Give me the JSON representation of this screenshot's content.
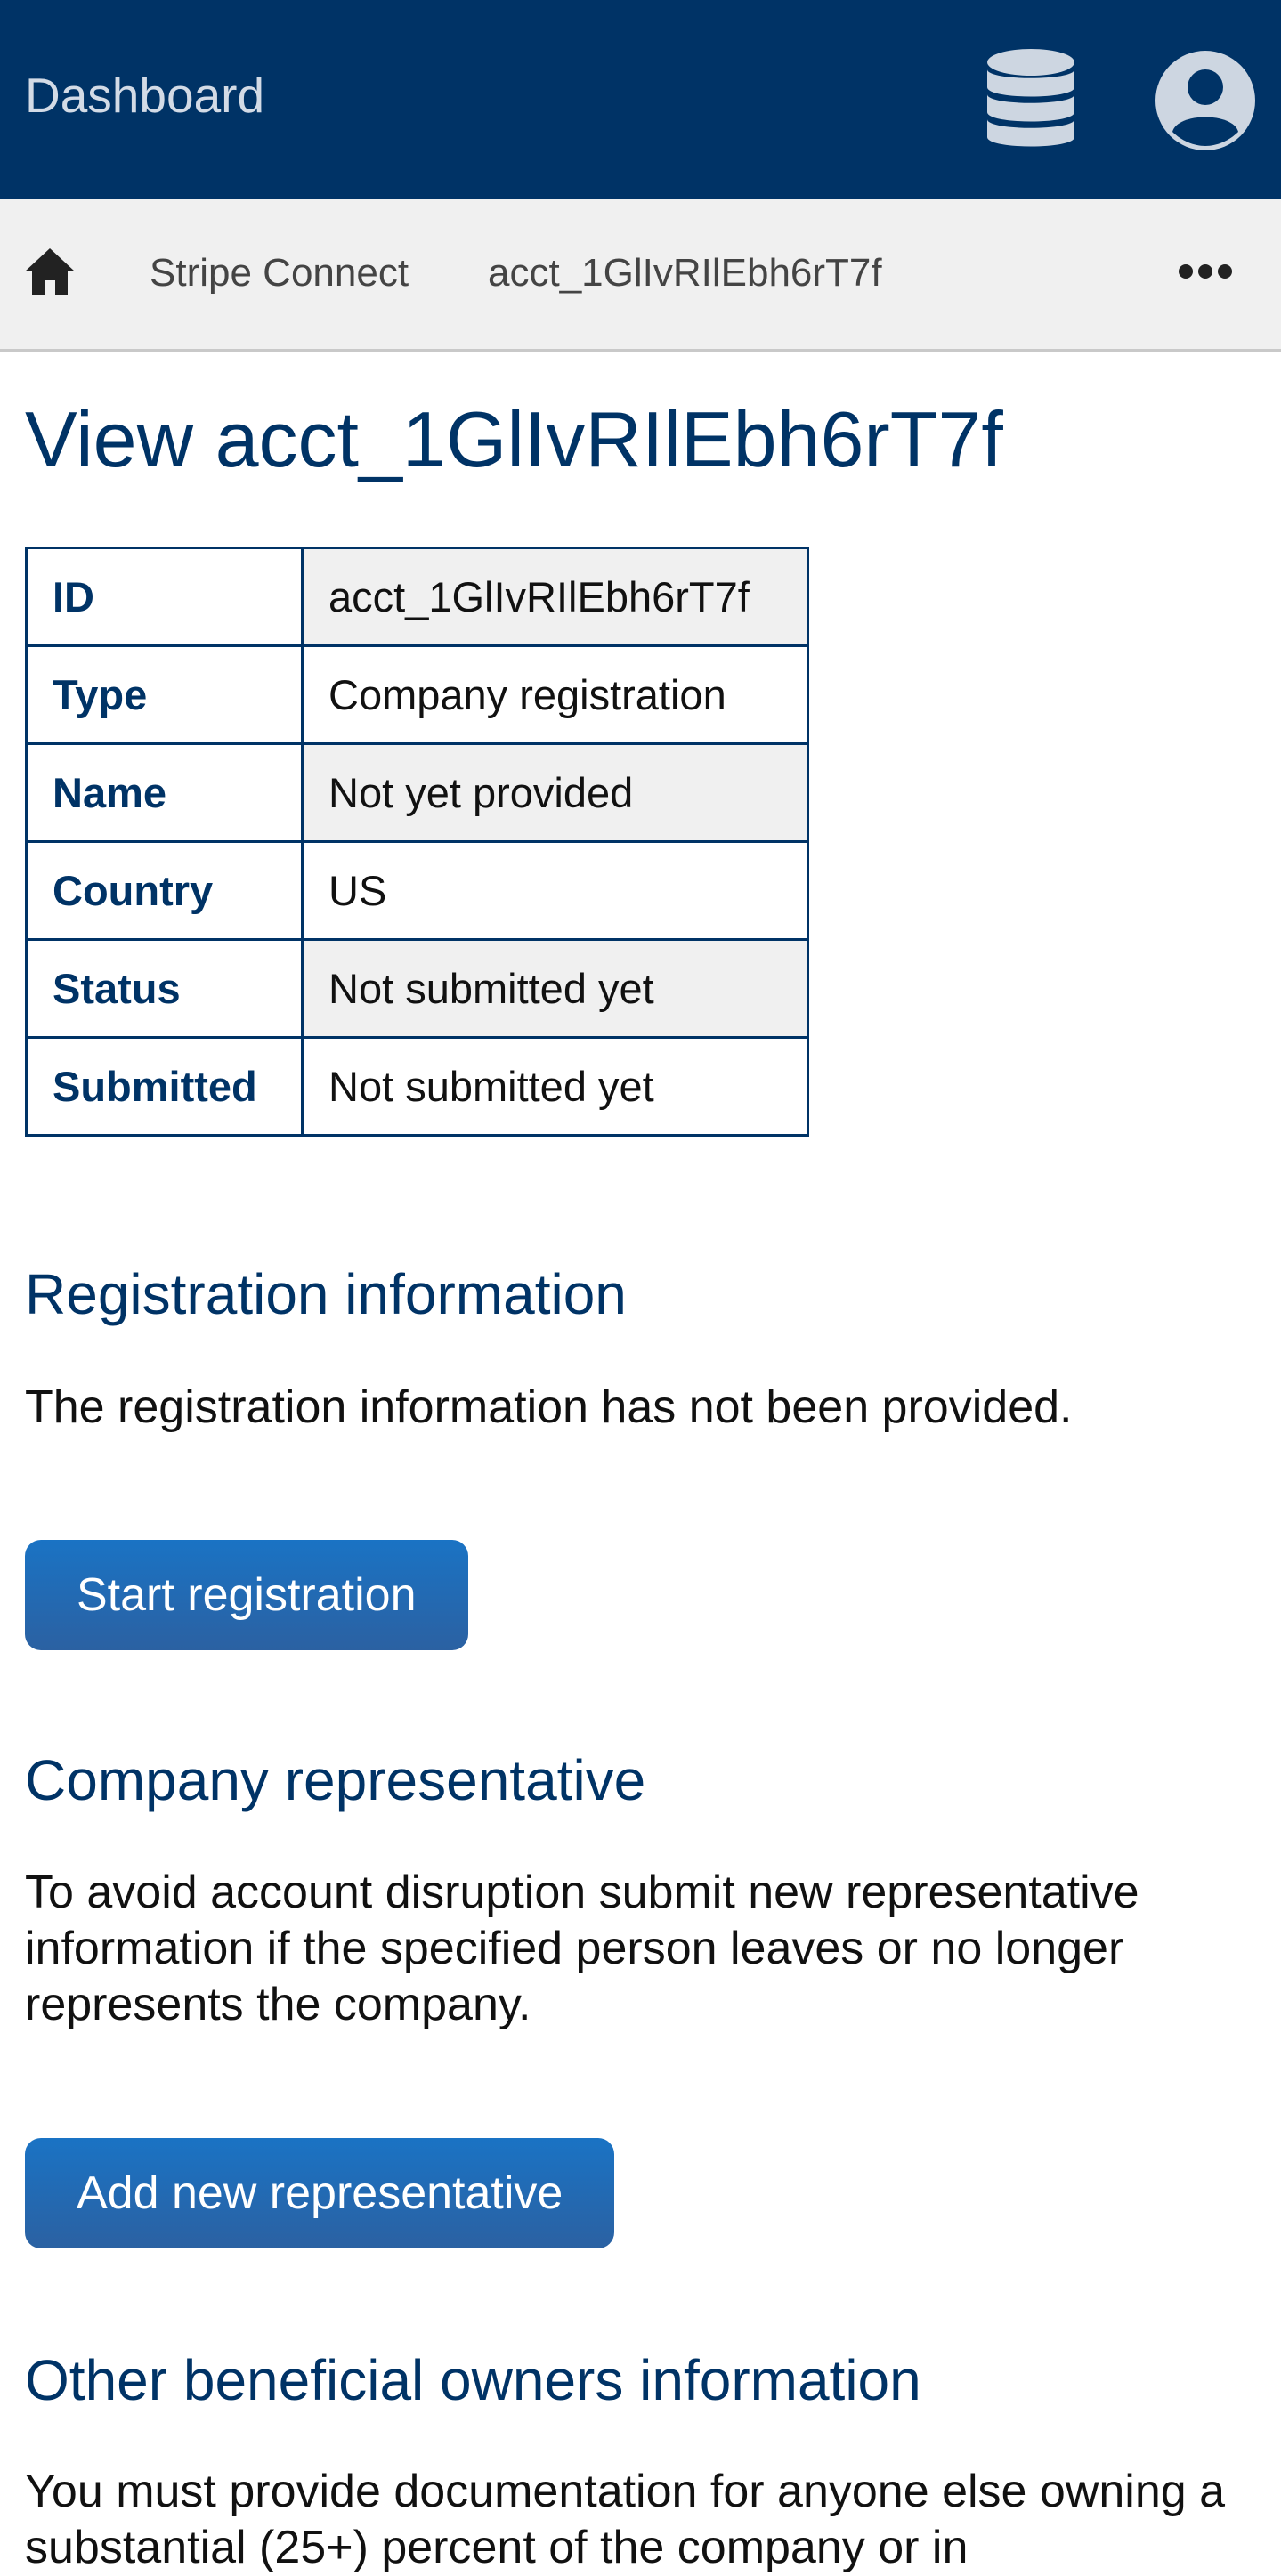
{
  "header": {
    "title": "Dashboard",
    "icons": {
      "database": "database-icon",
      "account": "user-account-icon"
    },
    "background": "#003366"
  },
  "breadcrumb": {
    "home_icon": "home-icon",
    "items": [
      "Stripe Connect",
      "acct_1GlIvRIlEbh6rT7f"
    ],
    "more_icon": "more-horizontal-icon"
  },
  "page": {
    "title": "View acct_1GlIvRIlEbh6rT7f"
  },
  "details": [
    {
      "key": "ID",
      "value": "acct_1GlIvRIlEbh6rT7f"
    },
    {
      "key": "Type",
      "value": "Company registration"
    },
    {
      "key": "Name",
      "value": "Not yet provided"
    },
    {
      "key": "Country",
      "value": "US"
    },
    {
      "key": "Status",
      "value": "Not submitted yet"
    },
    {
      "key": "Submitted",
      "value": "Not submitted yet"
    }
  ],
  "registration": {
    "heading": "Registration information",
    "text": "The registration information has not been provided.",
    "button": "Start registration"
  },
  "representative": {
    "heading": "Company representative",
    "text": "To avoid account disruption submit new representative information if the specified person leaves or no longer represents the company.",
    "button": "Add new representative"
  },
  "owners": {
    "heading": "Other beneficial owners information",
    "text": "You must provide documentation for anyone else owning a substantial (25+) percent of the company or in"
  },
  "colors": {
    "brand": "#003366",
    "button": "#1a73c4",
    "stripe_row": "#f0f0f0"
  }
}
